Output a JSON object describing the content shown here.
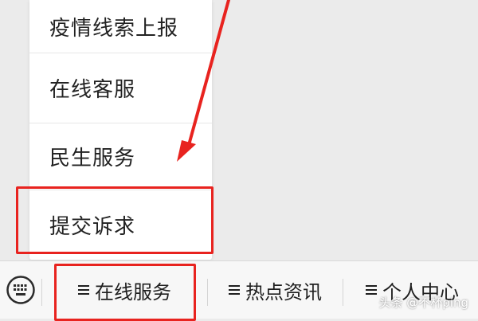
{
  "menu": {
    "items": [
      {
        "label": "疫情线索上报"
      },
      {
        "label": "在线客服"
      },
      {
        "label": "民生服务"
      },
      {
        "label": "提交诉求"
      }
    ]
  },
  "tabbar": {
    "tabs": [
      {
        "label": "在线服务",
        "icon": "menu-icon"
      },
      {
        "label": "热点资讯",
        "icon": "menu-icon"
      },
      {
        "label": "个人中心",
        "icon": "menu-icon"
      }
    ],
    "keyboard_icon": "keyboard-icon"
  },
  "annotations": {
    "color": "#e8231f"
  },
  "watermark": {
    "text": "头条 @不杯ping"
  }
}
